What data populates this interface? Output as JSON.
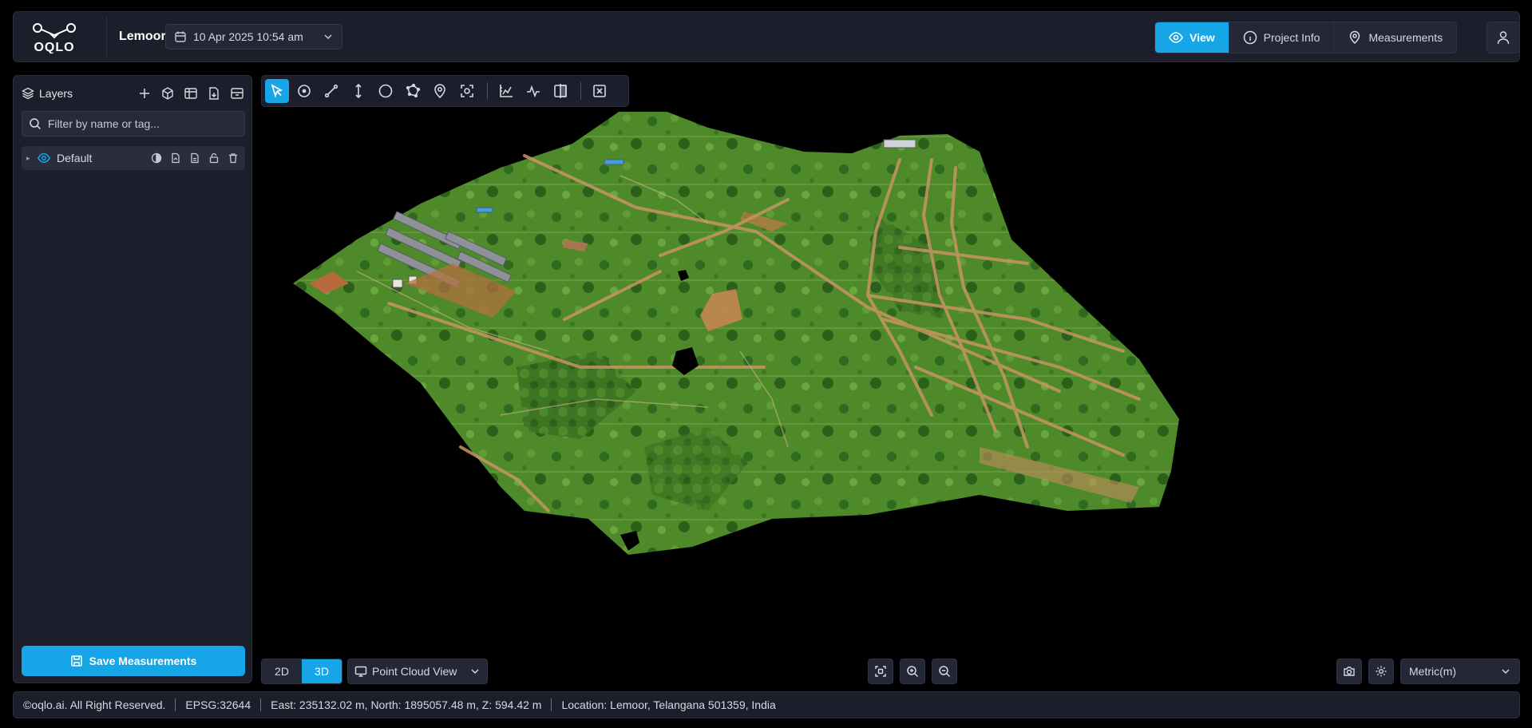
{
  "header": {
    "logo_text": "OQLO",
    "project_name": "Lemoor",
    "date": "10 Apr 2025 10:54 am",
    "nav": [
      {
        "label": "View",
        "active": true,
        "icon": "eye-icon"
      },
      {
        "label": "Project Info",
        "active": false,
        "icon": "info-icon"
      },
      {
        "label": "Measurements",
        "active": false,
        "icon": "map-pin-icon"
      }
    ],
    "user_icon": "user-icon"
  },
  "layers_panel": {
    "title": "Layers",
    "filter_placeholder": "Filter by name or tag...",
    "layers": [
      {
        "name": "Default",
        "visible": true
      }
    ],
    "save_label": "Save Measurements"
  },
  "toolbar": {
    "tools": [
      "select-tool",
      "point-tool",
      "distance-tool",
      "height-tool",
      "circle-tool",
      "area-tool",
      "marker-tool",
      "focus-tool",
      "profile-tool",
      "elevation-tool",
      "compare-tool",
      "clear-tool"
    ],
    "active_tool": "select-tool"
  },
  "view_controls": {
    "mode_2d": "2D",
    "mode_3d": "3D",
    "active_mode": "3D",
    "render_mode": "Point Cloud View",
    "units": "Metric(m)"
  },
  "status_bar": {
    "copyright": "©oqlo.ai. All Right Reserved.",
    "epsg": "EPSG:32644",
    "coords": "East: 235132.02 m, North: 1895057.48 m, Z: 594.42 m",
    "location": "Location: Lemoor, Telangana 501359, India"
  },
  "colors": {
    "accent": "#16a6e8",
    "panel_bg": "#1c1f2b",
    "app_bg": "#000000"
  }
}
